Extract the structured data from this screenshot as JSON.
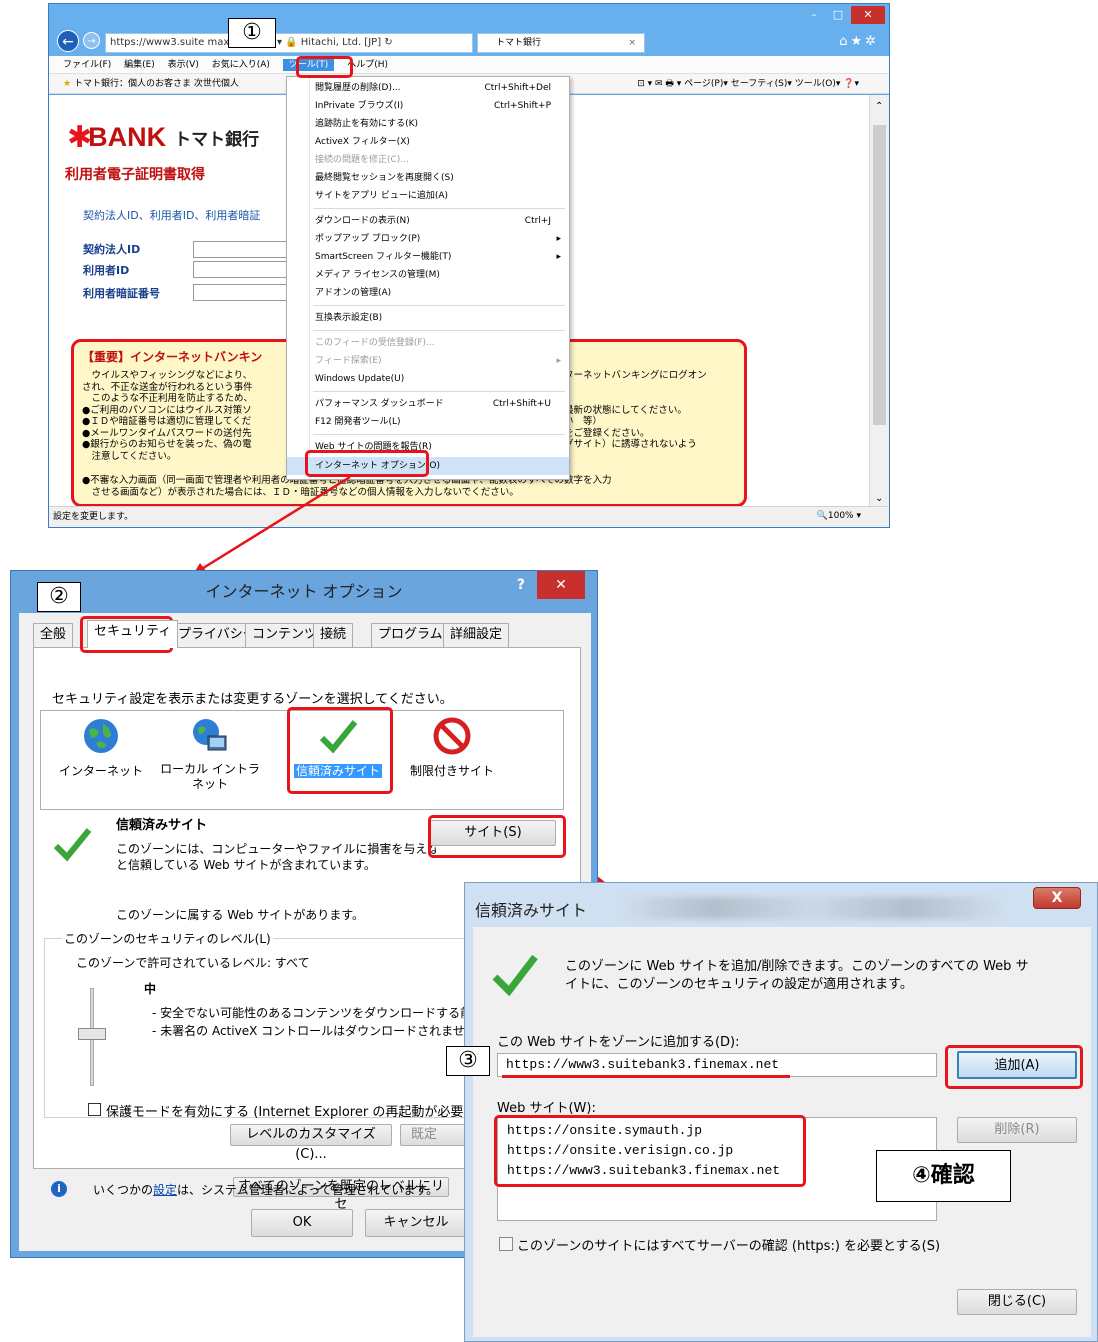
{
  "steps": {
    "s1": "①",
    "s2": "②",
    "s3": "③",
    "s4": "④確認"
  },
  "ie": {
    "address": "https://www3.suite         max.net/",
    "address_tail": "ρ ▾ 🔒 Hitachi, Ltd. [JP] ↻",
    "tab_title": "トマト銀行",
    "menubar": [
      "ファイル(F)",
      "編集(E)",
      "表示(V)",
      "お気に入り(A)",
      "ツール(T)",
      "ヘルプ(H)"
    ],
    "favbar": "トマト銀行：個人のお客さま   次世代個人",
    "commands": "⊡ ▾ ✉ 🖶 ▾ ページ(P)▾ セーフティ(S)▾ ツール(O)▾ ❓▾",
    "status": "設定を変更します。",
    "zoom": "🔍100%  ▾",
    "page": {
      "bank_logo": "BANK",
      "bank_name": "トマト銀行",
      "title": "利用者電子証明書取得",
      "intro": "契約法人ID、利用者ID、利用者暗証",
      "fields": [
        "契約法人ID",
        "利用者ID",
        "利用者暗証番号"
      ],
      "notice_title": "【重要】インターネットバンキン",
      "notice_left": [
        "　ウイルスやフィッシングなどにより、",
        "され、不正な送金が行われるという事件",
        "　このような不正利用を防止するため、",
        "●ご利用のパソコンにはウイルス対策ソ",
        "●ＩＤや暗証番号は適切に管理してくだ",
        "●メールワンタイムパスワードの送付先",
        "●銀行からのお知らせを装った、偽の電",
        "　注意してください。"
      ],
      "notice_right": [
        "ターネットバンキングにログオン",
        "",
        "",
        "最新の状態にしてください。",
        "い　等）",
        "をご登録ください。",
        "グサイト）に誘導されないよう"
      ],
      "notice_bottom": [
        "●不審な入力画面（同一画面で管理者や利用者の暗証番号と確認暗証番号を入力させる画面や、乱数表のすべての数字を入力",
        "　させる画面など）が表示された場合には、ＩＤ・暗証番号などの個人情報を入力しないでください。"
      ]
    },
    "tools_menu": [
      {
        "label": "閲覧履歴の削除(D)...",
        "shortcut": "Ctrl+Shift+Del"
      },
      {
        "label": "InPrivate ブラウズ(I)",
        "shortcut": "Ctrl+Shift+P"
      },
      {
        "label": "追跡防止を有効にする(K)"
      },
      {
        "label": "ActiveX フィルター(X)"
      },
      {
        "label": "接続の問題を修正(C)...",
        "disabled": true
      },
      {
        "label": "最終閲覧セッションを再度開く(S)"
      },
      {
        "label": "サイトをアプリ ビューに追加(A)"
      },
      {
        "label": "ダウンロードの表示(N)",
        "shortcut": "Ctrl+J"
      },
      {
        "label": "ポップアップ ブロック(P)",
        "arrow": "▸"
      },
      {
        "label": "SmartScreen フィルター機能(T)",
        "arrow": "▸"
      },
      {
        "label": "メディア ライセンスの管理(M)"
      },
      {
        "label": "アドオンの管理(A)"
      },
      {
        "label": "互換表示設定(B)"
      },
      {
        "label": "このフィードの受信登録(F)...",
        "disabled": true
      },
      {
        "label": "フィード探索(E)",
        "disabled": true,
        "arrow": "▸"
      },
      {
        "label": "Windows Update(U)"
      },
      {
        "label": "パフォーマンス ダッシュボード",
        "shortcut": "Ctrl+Shift+U"
      },
      {
        "label": "F12 開発者ツール(L)"
      },
      {
        "label": "Web サイトの問題を報告(R)"
      },
      {
        "label": "インターネット オプション(O)"
      }
    ]
  },
  "options": {
    "title": "インターネット オプション",
    "help": "?",
    "close": "✕",
    "tabs": [
      "全般",
      "セキュリティ",
      "プライバシー",
      "コンテンツ",
      "接続",
      "プログラム",
      "詳細設定"
    ],
    "zone_prompt": "セキュリティ設定を表示または変更するゾーンを選択してください。",
    "zones": [
      "インターネット",
      "ローカル イントラネット",
      "信頼済みサイト",
      "制限付きサイト"
    ],
    "zone_name": "信頼済みサイト",
    "zone_desc1": "このゾーンには、コンピューターやファイルに損害を与えない",
    "zone_desc2": "と信頼している Web サイトが含まれています。",
    "sites_button": "サイト(S)",
    "has_sites": "このゾーンに属する Web サイトがあります。",
    "level_group": "このゾーンのセキュリティのレベル(L)",
    "allowed_levels": "このゾーンで許可されているレベル: すべて",
    "level_name": "中",
    "level_b1": "- 安全でない可能性のあるコンテンツをダウンロードする前",
    "level_b2": "- 未署名の ActiveX コントロールはダウンロードされませ",
    "protected_mode": "保護モードを有効にする (Internet Explorer の再起動が必要",
    "custom_level": "レベルのカスタマイズ(C)...",
    "default_level": "既定",
    "reset_all": "すべてのゾーンを既定のレベルにリセ",
    "admin_note_a": "いくつかの",
    "admin_note_link": "設定",
    "admin_note_b": "は、システム管理者によって管理されています。",
    "ok": "OK",
    "cancel": "キャンセル"
  },
  "trusted": {
    "title": "信頼済みサイト",
    "close": "X",
    "desc1": "このゾーンに Web サイトを追加/削除できます。このゾーンのすべての Web サ",
    "desc2": "イトに、このゾーンのセキュリティの設定が適用されます。",
    "add_label": "この Web サイトをゾーンに追加する(D):",
    "add_value": "https://www3.suitebank3.finemax.net",
    "add_button": "追加(A)",
    "list_label": "Web サイト(W):",
    "sites": [
      "https://onsite.symauth.jp",
      "https://onsite.verisign.co.jp",
      "https://www3.suitebank3.finemax.net"
    ],
    "remove_button": "削除(R)",
    "require_https": "このゾーンのサイトにはすべてサーバーの確認 (https:) を必要とする(S)",
    "close_button": "閉じる(C)"
  }
}
